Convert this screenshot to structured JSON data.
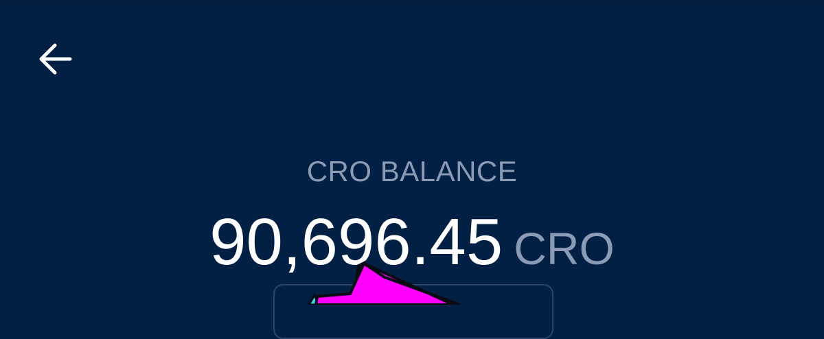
{
  "header": {
    "back_icon": "arrow-left-icon"
  },
  "balance": {
    "label": "CRO BALANCE",
    "amount": "90,696.45",
    "unit": "CRO"
  },
  "overlay": {
    "pointer_icon": "pointer-arrow-icon"
  },
  "colors": {
    "background": "#021f44",
    "label_muted": "#8b9ab5",
    "amount_text": "#ffffff",
    "pointer_fill": "#ff00ff",
    "pointer_accent": "#3ad7e8"
  }
}
